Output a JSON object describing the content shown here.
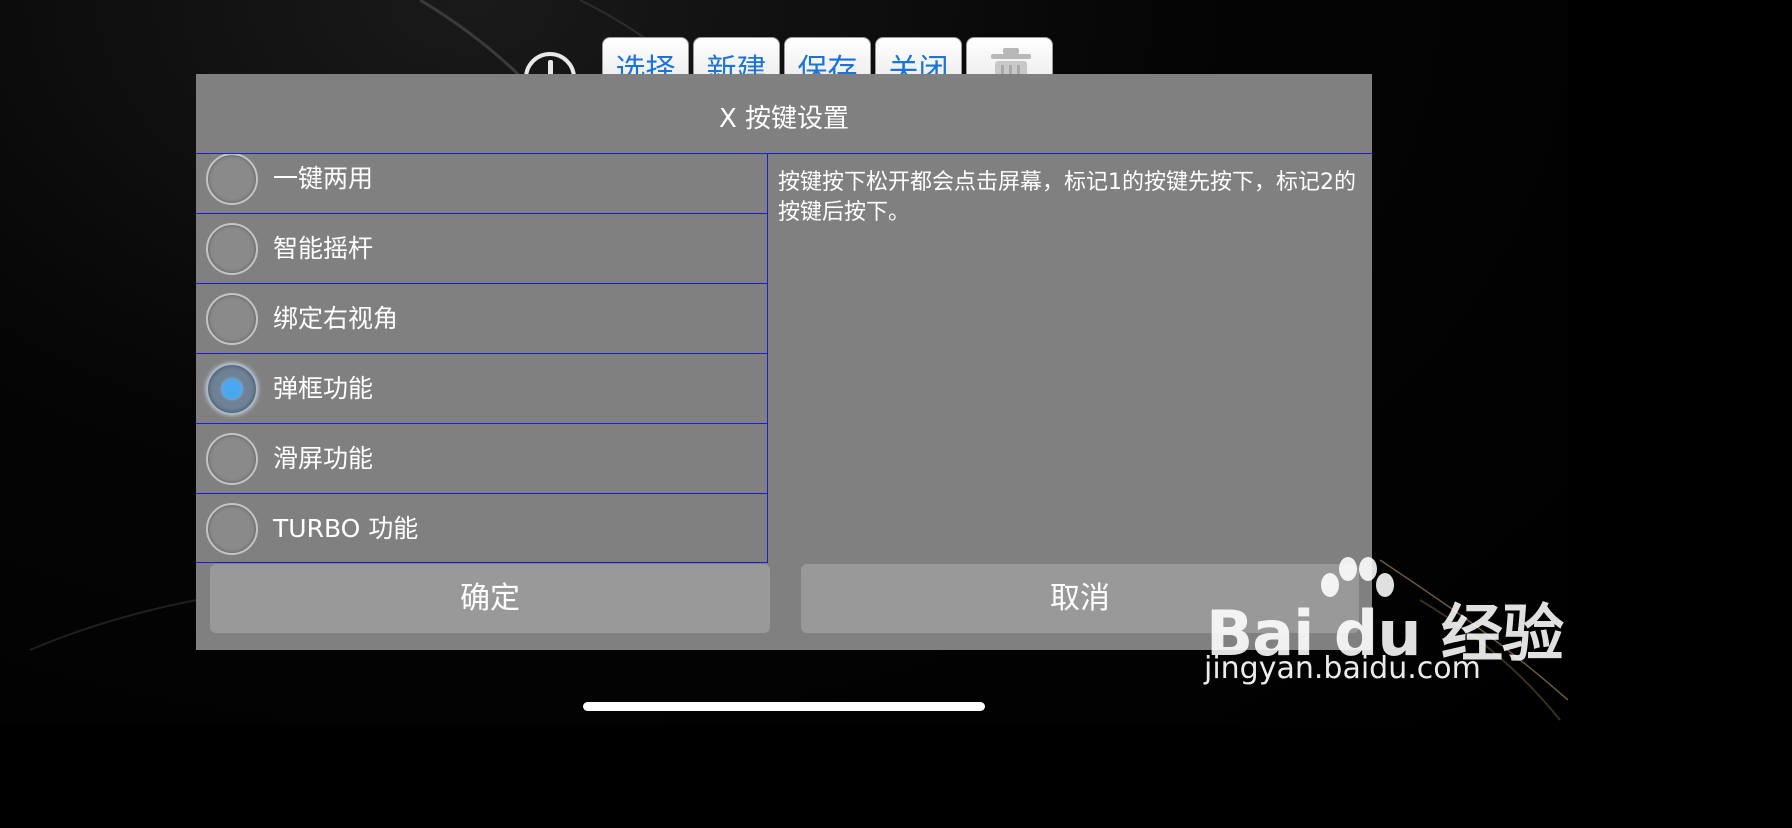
{
  "toolbar": {
    "buttons": [
      "选择",
      "新建",
      "保存",
      "关闭"
    ],
    "power_icon": "power-icon",
    "trash_icon": "trash-icon"
  },
  "dialog": {
    "title": "X 按键设置",
    "options": [
      {
        "label": "一键两用",
        "checked": false
      },
      {
        "label": "智能摇杆",
        "checked": false
      },
      {
        "label": "绑定右视角",
        "checked": false
      },
      {
        "label": "弹框功能",
        "checked": true
      },
      {
        "label": "滑屏功能",
        "checked": false
      },
      {
        "label": "TURBO 功能",
        "checked": false
      }
    ],
    "description": "按键按下松开都会点击屏幕，标记1的按键先按下，标记2的按键后按下。",
    "confirm_label": "确定",
    "cancel_label": "取消"
  },
  "watermark": {
    "brand": "Bai du 经验",
    "url": "jingyan.baidu.com"
  },
  "colors": {
    "dialog_bg": "#808080",
    "divider": "#1d1dd6",
    "button_bg": "#999999",
    "toolbar_text": "#1a73d6",
    "radio_dot": "#4aa8f0"
  }
}
